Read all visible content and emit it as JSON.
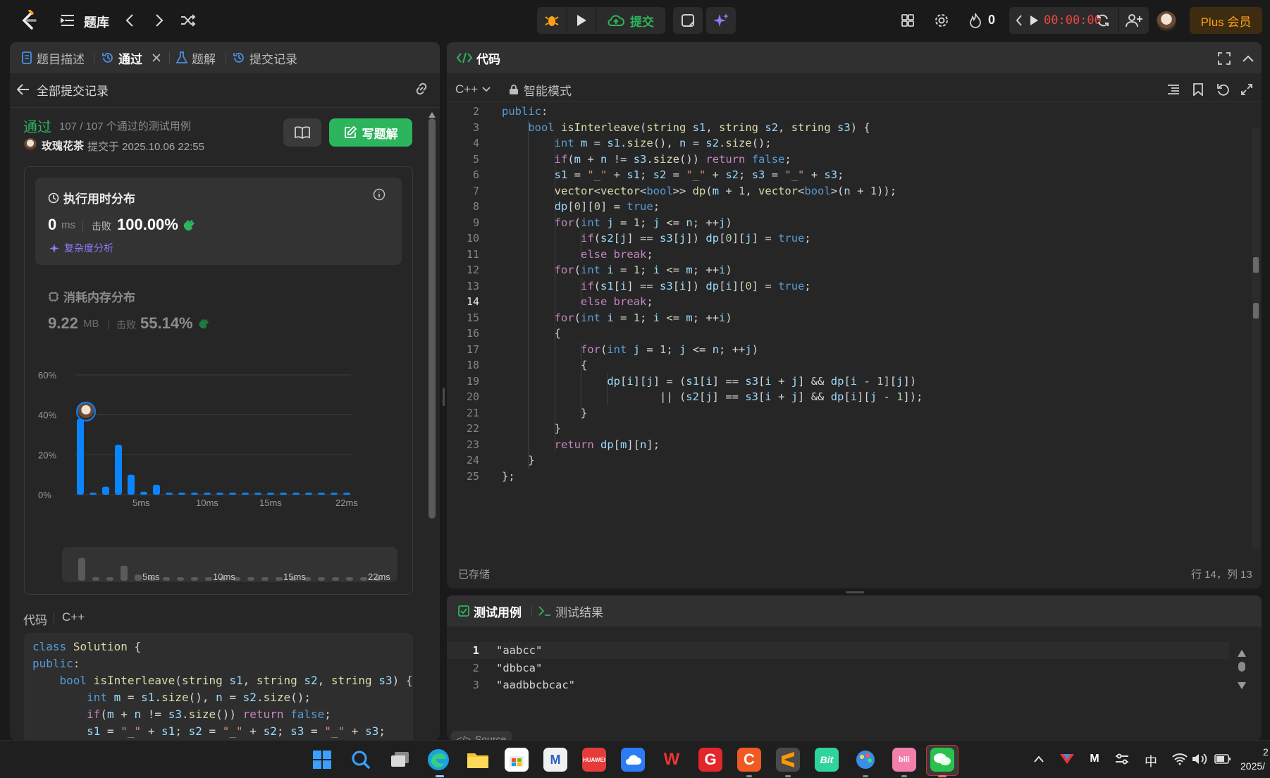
{
  "topbar": {
    "problem_list_label": "题库",
    "submit_label": "提交",
    "streak_count": "0",
    "timer": "00:00:00",
    "plus_label": "Plus 会员"
  },
  "left_tabs": {
    "description": "题目描述",
    "accepted": "通过",
    "solutions": "题解",
    "submissions": "提交记录"
  },
  "submission": {
    "back_label": "全部提交记录",
    "status": "通过",
    "testcases": "107 / 107 个通过的测试用例",
    "user": "玫瑰花茶",
    "submitted_at": "提交于 2025.10.06 22:55",
    "write_solution_label": "写题解"
  },
  "runtime": {
    "title": "执行用时分布",
    "value": "0",
    "unit": "ms",
    "beats_label": "击败",
    "beats": "100.00%",
    "complexity_link": "复杂度分析"
  },
  "memory": {
    "title": "消耗内存分布",
    "value": "9.22",
    "unit": "MB",
    "beats_label": "击败",
    "beats": "55.14%"
  },
  "chart_data": {
    "type": "bar",
    "ylabel": "",
    "xlabel": "",
    "y_ticks": [
      "60%",
      "40%",
      "20%",
      "0%"
    ],
    "ylim": [
      0,
      60
    ],
    "x_ticks": [
      "5ms",
      "10ms",
      "15ms",
      "22ms"
    ],
    "values": [
      38,
      1,
      4,
      25,
      10,
      1.5,
      5,
      1,
      1,
      1,
      1,
      1,
      1,
      1,
      1,
      1,
      1,
      1,
      1,
      1,
      1,
      1
    ],
    "highlight_index": 0,
    "accent": "#0a84ff",
    "grid": true
  },
  "mini_chart": {
    "ticks": [
      "5ms",
      "10ms",
      "15ms",
      "22ms"
    ]
  },
  "left_code": {
    "title": "代码",
    "lang": "C++",
    "lines": [
      "class Solution {",
      "public:",
      "    bool isInterleave(string s1, string s2, string s3) {",
      "        int m = s1.size(), n = s2.size();",
      "        if(m + n != s3.size()) return false;",
      "        s1 = \"_\" + s1; s2 = \"_\" + s2; s3 = \"_\" + s3;"
    ]
  },
  "editor": {
    "title": "代码",
    "lang": "C++",
    "mode": "智能模式",
    "saved": "已存储",
    "cursor": "行 14，列 13",
    "current_line": 14
  },
  "code_lines": [
    {
      "n": "2",
      "t": "public:"
    },
    {
      "n": "3",
      "t": "    bool isInterleave(string s1, string s2, string s3) {"
    },
    {
      "n": "4",
      "t": "        int m = s1.size(), n = s2.size();"
    },
    {
      "n": "5",
      "t": "        if(m + n != s3.size()) return false;"
    },
    {
      "n": "6",
      "t": "        s1 = \"_\" + s1; s2 = \"_\" + s2; s3 = \"_\" + s3;"
    },
    {
      "n": "7",
      "t": "        vector<vector<bool>> dp(m + 1, vector<bool>(n + 1));"
    },
    {
      "n": "8",
      "t": "        dp[0][0] = true;"
    },
    {
      "n": "9",
      "t": "        for(int j = 1; j <= n; ++j)"
    },
    {
      "n": "10",
      "t": "            if(s2[j] == s3[j]) dp[0][j] = true;"
    },
    {
      "n": "11",
      "t": "            else break;"
    },
    {
      "n": "12",
      "t": "        for(int i = 1; i <= m; ++i)"
    },
    {
      "n": "13",
      "t": "            if(s1[i] == s3[i]) dp[i][0] = true;"
    },
    {
      "n": "14",
      "t": "            else break;"
    },
    {
      "n": "15",
      "t": "        for(int i = 1; i <= m; ++i)"
    },
    {
      "n": "16",
      "t": "        {"
    },
    {
      "n": "17",
      "t": "            for(int j = 1; j <= n; ++j)"
    },
    {
      "n": "18",
      "t": "            {"
    },
    {
      "n": "19",
      "t": "                dp[i][j] = (s1[i] == s3[i + j] && dp[i - 1][j])"
    },
    {
      "n": "20",
      "t": "                        || (s2[j] == s3[i + j] && dp[i][j - 1]);"
    },
    {
      "n": "21",
      "t": "            }"
    },
    {
      "n": "22",
      "t": "        }"
    },
    {
      "n": "23",
      "t": "        return dp[m][n];"
    },
    {
      "n": "24",
      "t": "    }"
    },
    {
      "n": "25",
      "t": "};"
    }
  ],
  "testpanel": {
    "testcase_tab": "测试用例",
    "result_tab": "测试结果",
    "cases": [
      {
        "n": "1",
        "v": "\"aabcc\""
      },
      {
        "n": "2",
        "v": "\"dbbca\""
      },
      {
        "n": "3",
        "v": "\"aadbbcbcac\""
      }
    ],
    "source_label": "Source"
  },
  "taskbar": {
    "lang_indicator": "中",
    "clock_partial": "2",
    "date_partial": "2025/"
  }
}
